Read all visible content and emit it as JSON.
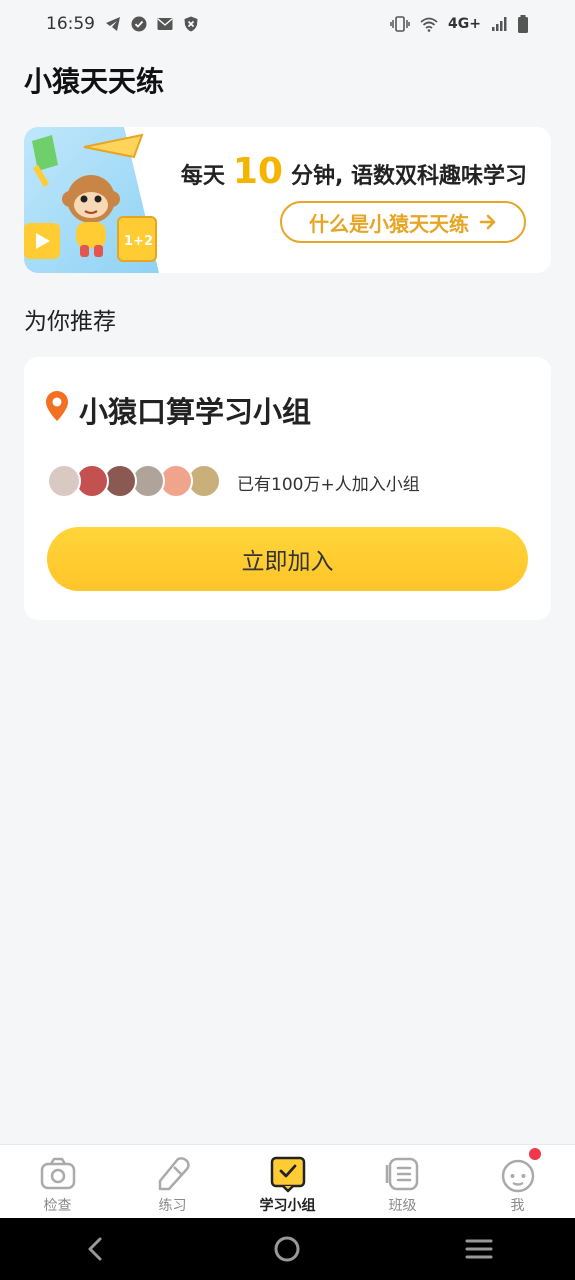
{
  "status_bar": {
    "time": "16:59",
    "network": "4G+",
    "icons": [
      "telegram-icon",
      "check-badge-icon",
      "mail-icon",
      "shield-icon",
      "vibrate-icon",
      "wifi-icon",
      "signal-icon",
      "battery-icon"
    ]
  },
  "page": {
    "title": "小猿天天练"
  },
  "banner": {
    "text_before": "每天",
    "highlight_number": "10",
    "text_after": "分钟, 语数双科趣味学习",
    "button_label": "什么是小猿天天练",
    "button_icon": "arrow-right-icon"
  },
  "recommend": {
    "section_title": "为你推荐",
    "group_name": "小猿口算学习小组",
    "member_text": "已有100万+人加入小组",
    "join_label": "立即加入",
    "avatar_colors": [
      "#d9c9c2",
      "#c2514f",
      "#8a5a52",
      "#b0a49a",
      "#f0a48c",
      "#c9b07a"
    ]
  },
  "tabs": [
    {
      "label": "检查",
      "icon": "camera-icon"
    },
    {
      "label": "练习",
      "icon": "pencil-icon"
    },
    {
      "label": "学习小组",
      "icon": "study-group-icon",
      "active": true
    },
    {
      "label": "班级",
      "icon": "class-icon"
    },
    {
      "label": "我",
      "icon": "profile-icon",
      "badge": true
    }
  ],
  "colors": {
    "accent": "#ffcc33",
    "banner_highlight": "#f5b400",
    "badge": "#f0384a"
  }
}
